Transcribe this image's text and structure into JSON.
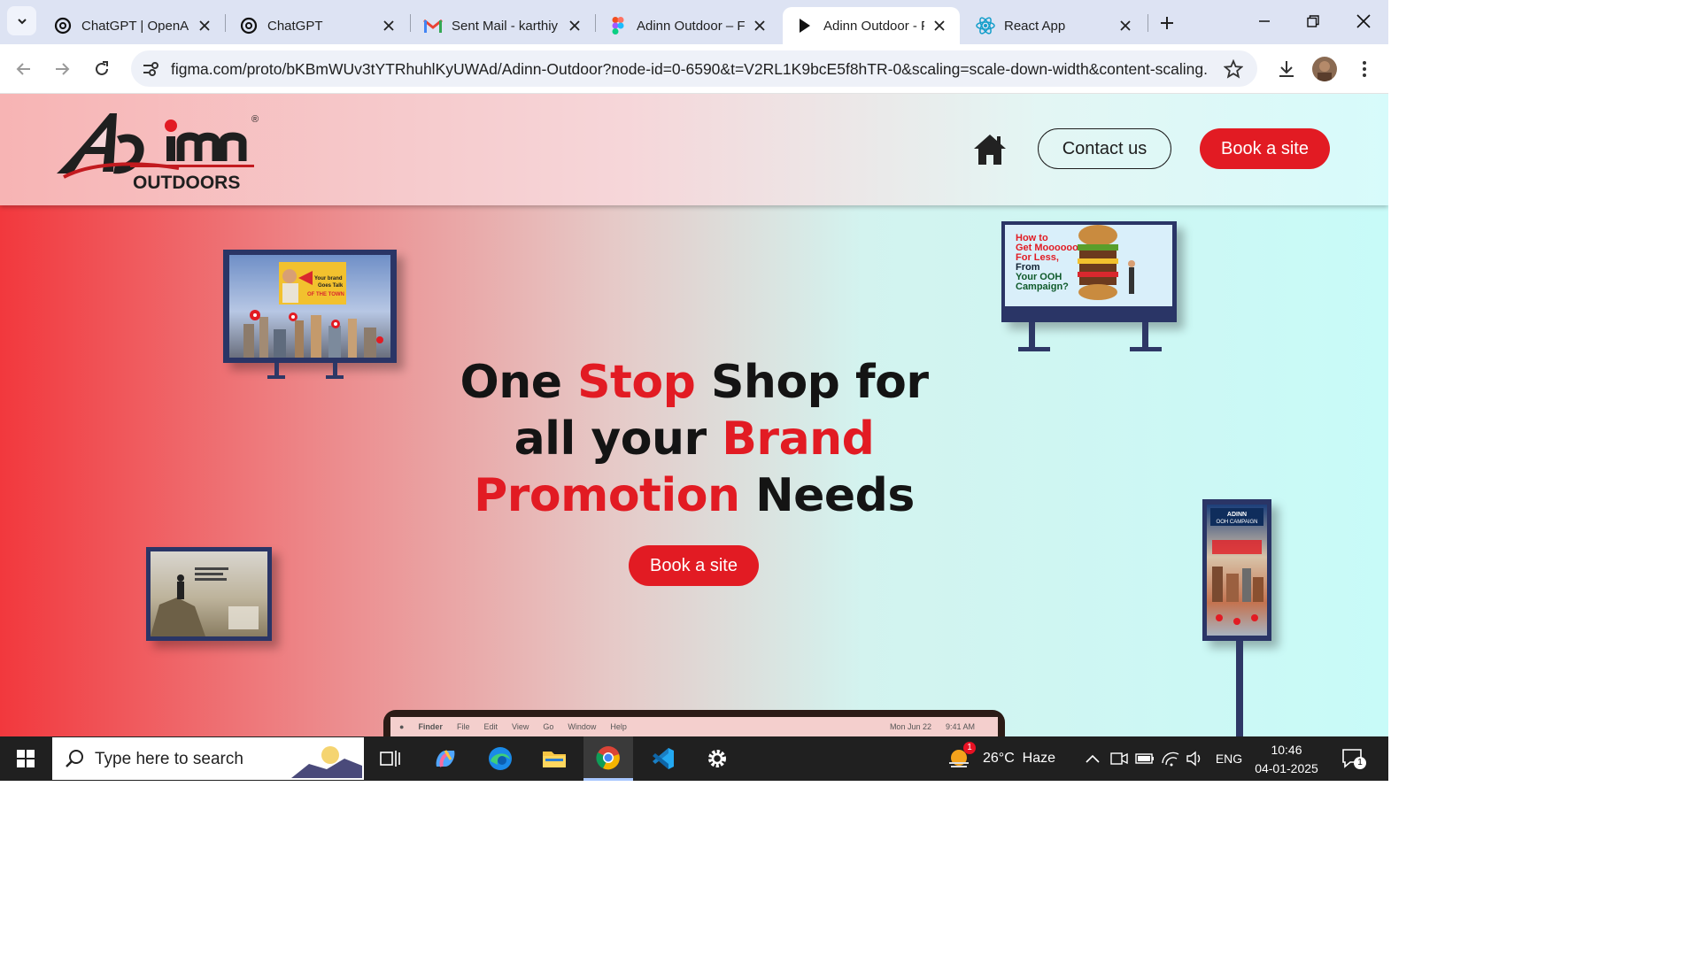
{
  "browser": {
    "tabs": [
      {
        "title": "ChatGPT | OpenAI",
        "icon": "openai-icon",
        "active": false
      },
      {
        "title": "ChatGPT",
        "icon": "openai-icon",
        "active": false
      },
      {
        "title": "Sent Mail - karthiy",
        "icon": "gmail-icon",
        "active": false
      },
      {
        "title": "Adinn Outdoor – F",
        "icon": "figma-icon",
        "active": false
      },
      {
        "title": "Adinn Outdoor - P",
        "icon": "play-icon",
        "active": true
      },
      {
        "title": "React App",
        "icon": "react-icon",
        "active": false
      }
    ],
    "url": "figma.com/proto/bKBmWUv3tYTRhuhlKyUWAd/Adinn-Outdoor?node-id=0-6590&t=V2RL1K9bcE5f8hTR-0&scaling=scale-down-width&content-scaling..."
  },
  "site": {
    "logo": {
      "text_main": "Ad imn",
      "text_sub": "OUTDOORS",
      "registered": "®"
    },
    "nav": {
      "contact_label": "Contact us",
      "book_label": "Book a site"
    },
    "hero": {
      "line1_a": "One ",
      "line1_b": "Stop",
      "line1_c": " Shop for",
      "line2_a": "all your ",
      "line2_b": "Brand",
      "line3_a": "Promotion",
      "line3_b": " Needs",
      "cta_label": "Book a site"
    },
    "billboards": {
      "top_left": {
        "line1": "Your brand",
        "line2": "Goes Talk",
        "line3": "OF THE TOWN"
      },
      "top_right": {
        "line1": "How to",
        "line2": "Get Moooooooooore",
        "line3": "For Less,",
        "line4": "From",
        "line5": "Your OOH",
        "line6": "Campaign?"
      },
      "bottom_right": {
        "line1": "ADINN",
        "line2": "OOH CAMPAIGN"
      }
    },
    "laptop_menubar": [
      "Finder",
      "File",
      "Edit",
      "View",
      "Go",
      "Window",
      "Help",
      "Mon Jun 22",
      "9:41 AM"
    ],
    "colors": {
      "accent": "#e21b23",
      "frame": "#2a3566"
    }
  },
  "taskbar": {
    "search_placeholder": "Type here to search",
    "weather": "26°C  Haze",
    "weather_badge": "1",
    "language": "ENG",
    "time": "10:46",
    "date": "04-01-2025",
    "notification_count": "1"
  }
}
